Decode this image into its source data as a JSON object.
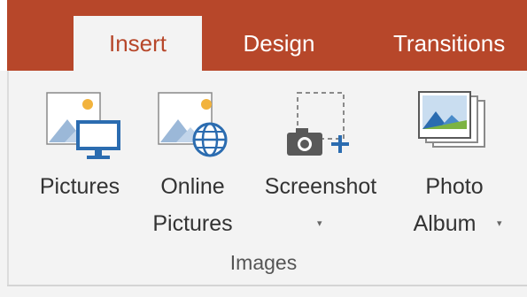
{
  "tabs": {
    "insert": "Insert",
    "design": "Design",
    "transitions": "Transitions"
  },
  "ribbon": {
    "pictures": {
      "line1": "Pictures"
    },
    "online_pictures": {
      "line1": "Online",
      "line2": "Pictures"
    },
    "screenshot": {
      "line1": "Screenshot",
      "dropdown": "▾"
    },
    "photo_album": {
      "line1": "Photo",
      "line2": "Album",
      "dropdown": "▾"
    },
    "group_label": "Images"
  },
  "icons": {
    "pictures": "pictures-icon",
    "online_pictures": "online-pictures-icon",
    "screenshot": "screenshot-icon",
    "photo_album": "photo-album-icon"
  },
  "colors": {
    "accent": "#b7472a",
    "icon_blue": "#2b6cb0",
    "sun": "#f2b33d",
    "mountain": "#9bb8d8"
  }
}
